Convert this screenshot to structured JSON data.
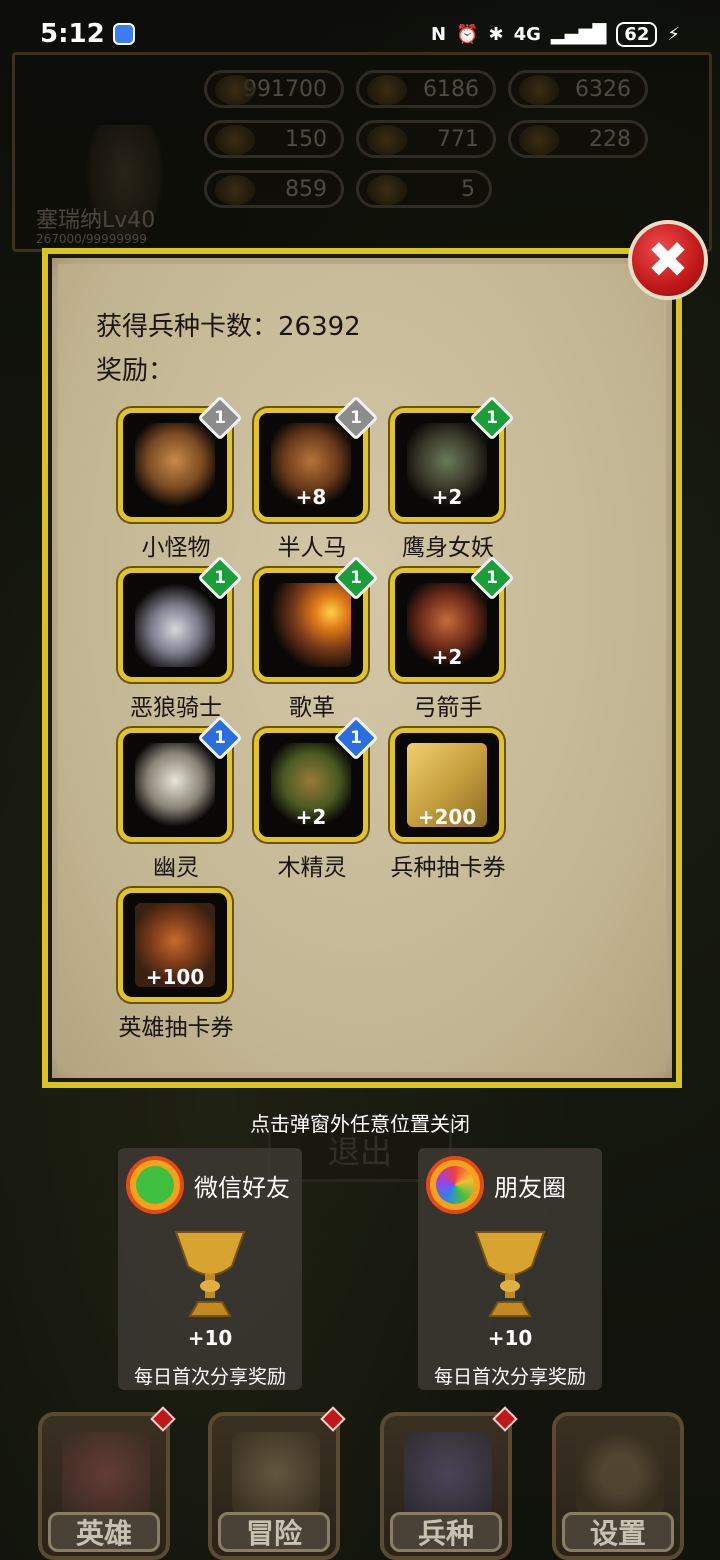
{
  "status_bar": {
    "time": "5:12",
    "network": "4G",
    "battery": "62"
  },
  "hero": {
    "name": "塞瑞纳Lv40",
    "exp": "267000/99999999",
    "resources": [
      "991700",
      "6186",
      "6326",
      "150",
      "771",
      "228",
      "859",
      "5"
    ]
  },
  "popup": {
    "cards_label": "获得兵种卡数：",
    "cards_count": "26392",
    "reward_label": "奖励：",
    "items": [
      {
        "name": "小怪物",
        "plus": "",
        "badge": "1",
        "badge_color": "#8c8c8c",
        "art": "imp-icon"
      },
      {
        "name": "半人马",
        "plus": "+8",
        "badge": "1",
        "badge_color": "#8c8c8c",
        "art": "centaur-icon"
      },
      {
        "name": "鹰身女妖",
        "plus": "+2",
        "badge": "1",
        "badge_color": "#1a9e3a",
        "art": "harpy-icon"
      },
      {
        "name": "恶狼骑士",
        "plus": "",
        "badge": "1",
        "badge_color": "#1a9e3a",
        "art": "wolf-rider-icon"
      },
      {
        "name": "歌革",
        "plus": "",
        "badge": "1",
        "badge_color": "#1a9e3a",
        "art": "gog-icon"
      },
      {
        "name": "弓箭手",
        "plus": "+2",
        "badge": "1",
        "badge_color": "#1a9e3a",
        "art": "archer-icon"
      },
      {
        "name": "幽灵",
        "plus": "",
        "badge": "1",
        "badge_color": "#2a6ee0",
        "art": "ghost-icon"
      },
      {
        "name": "木精灵",
        "plus": "+2",
        "badge": "1",
        "badge_color": "#2a6ee0",
        "art": "wood-elf-icon"
      },
      {
        "name": "兵种抽卡券",
        "plus": "+200",
        "badge": "",
        "badge_color": "",
        "art": "troop-ticket-icon"
      },
      {
        "name": "英雄抽卡券",
        "plus": "+100",
        "badge": "",
        "badge_color": "",
        "art": "hero-ticket-icon"
      }
    ]
  },
  "close_hint": "点击弹窗外任意位置关闭",
  "exit_label": "退出",
  "share": [
    {
      "title": "微信好友",
      "value": "+10",
      "desc": "每日首次分享奖励",
      "icon": "wechat-icon"
    },
    {
      "title": "朋友圈",
      "value": "+10",
      "desc": "每日首次分享奖励",
      "icon": "moments-icon"
    }
  ],
  "nav": [
    {
      "label": "英雄",
      "icon": "flag-icon"
    },
    {
      "label": "冒险",
      "icon": "scroll-icon"
    },
    {
      "label": "兵种",
      "icon": "wings-icon"
    },
    {
      "label": "设置",
      "icon": "gear-icon"
    }
  ],
  "colors": {
    "popup_border": "#d8c420",
    "item_frame": "#e1c42a",
    "close_button": "#c01818",
    "badge_gray": "#8c8c8c",
    "badge_green": "#1a9e3a",
    "badge_blue": "#2a6ee0"
  }
}
